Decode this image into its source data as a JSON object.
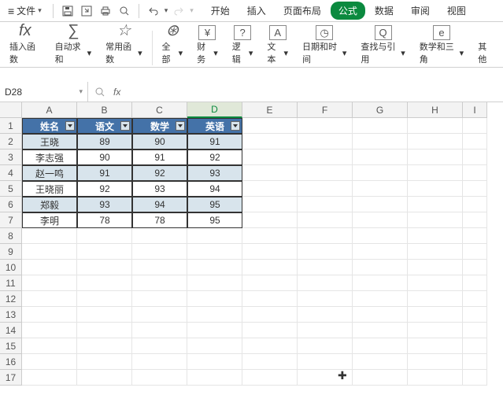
{
  "menubar": {
    "file_label": "文件"
  },
  "tabs": {
    "start": "开始",
    "insert": "插入",
    "layout": "页面布局",
    "formula": "公式",
    "data": "数据",
    "review": "审阅",
    "view": "视图"
  },
  "ribbon": {
    "insert_fn": "插入函数",
    "autosum": "自动求和",
    "common": "常用函数",
    "all": "全部",
    "finance": "财务",
    "logic": "逻辑",
    "text": "文本",
    "datetime": "日期和时间",
    "lookup": "查找与引用",
    "math": "数学和三角",
    "other": "其他"
  },
  "namebox": {
    "ref": "D28"
  },
  "columns": [
    "A",
    "B",
    "C",
    "D",
    "E",
    "F",
    "G",
    "H",
    "I"
  ],
  "rows": [
    "1",
    "2",
    "3",
    "4",
    "5",
    "6",
    "7",
    "8",
    "9",
    "10",
    "11",
    "12",
    "13",
    "14",
    "15",
    "16",
    "17"
  ],
  "selected_col_index": 3,
  "table": {
    "headers": [
      "姓名",
      "语文",
      "数学",
      "英语"
    ],
    "rows": [
      {
        "name": "王晓",
        "v": [
          "89",
          "90",
          "91"
        ],
        "alt": true
      },
      {
        "name": "李志强",
        "v": [
          "90",
          "91",
          "92"
        ],
        "alt": false
      },
      {
        "name": "赵一鸣",
        "v": [
          "91",
          "92",
          "93"
        ],
        "alt": true
      },
      {
        "name": "王晓丽",
        "v": [
          "92",
          "93",
          "94"
        ],
        "alt": false
      },
      {
        "name": "郑毅",
        "v": [
          "93",
          "94",
          "95"
        ],
        "alt": true
      },
      {
        "name": "李明",
        "v": [
          "78",
          "78",
          "95"
        ],
        "alt": false
      }
    ]
  }
}
